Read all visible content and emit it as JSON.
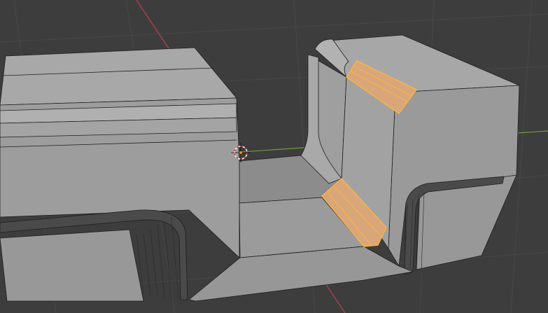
{
  "viewport": {
    "background_color": "#3d3d3d",
    "grid_color": "#484848",
    "x_axis_color": "#b8424a",
    "y_axis_color": "#6c9a3c",
    "mesh_face_color": "#9c9c9c",
    "mesh_shadow_color": "#8a8a8a",
    "mesh_highlight_color": "#b4b4b4",
    "edge_color": "#1e1e1e",
    "selected_face_color": "#e0a070",
    "selected_edge_color": "#ffb43c",
    "cursor_color": "#e04040"
  },
  "scene": {
    "object": "mesh",
    "mode": "edit",
    "selected_faces": 2,
    "cursor": "3d-cursor-icon"
  }
}
